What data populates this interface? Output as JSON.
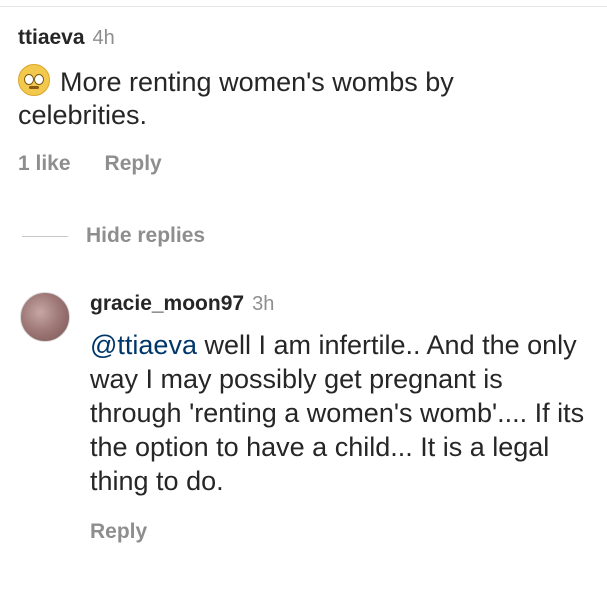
{
  "comment": {
    "username": "ttiaeva",
    "time": "4h",
    "emoji_icon": "flushed-face-icon",
    "text": "More renting women's wombs by celebrities.",
    "likes": "1 like",
    "reply_label": "Reply"
  },
  "replies_toggle": {
    "label": "Hide replies"
  },
  "reply": {
    "username": "gracie_moon97",
    "time": "3h",
    "mention": "@ttiaeva",
    "text": " well I am infertile.. And the only way I may possibly get pregnant is through 'renting a women's womb'.... If its the option to have a child... It is a legal thing to do.",
    "reply_label": "Reply"
  }
}
